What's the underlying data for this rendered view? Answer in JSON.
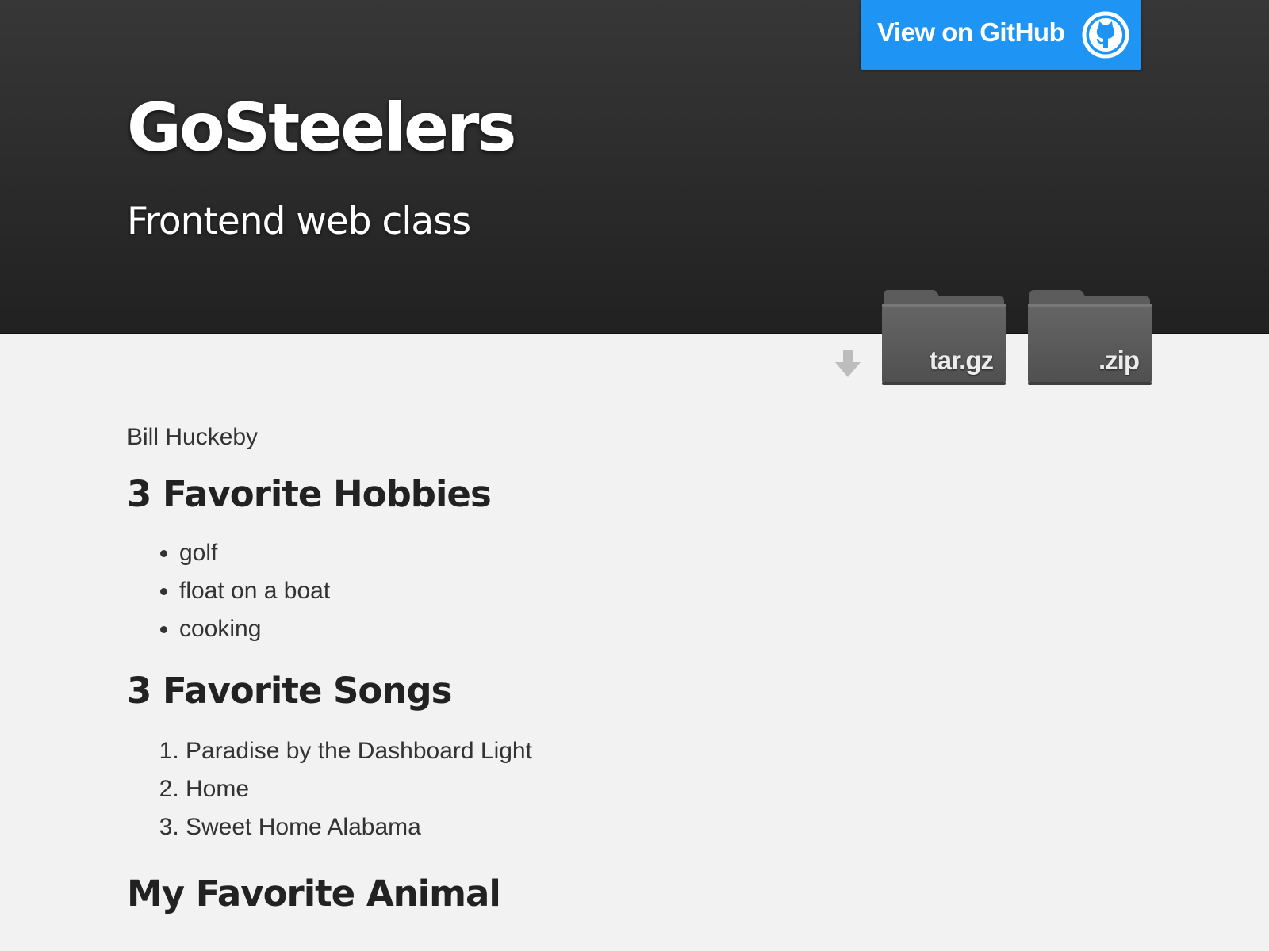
{
  "header": {
    "title": "GoSteelers",
    "subtitle": "Frontend web class"
  },
  "github_button": {
    "label": "View on GitHub",
    "icon": "github-octocat-icon",
    "color": "#1e95f5"
  },
  "downloads": {
    "arrow_icon": "download-arrow-icon",
    "items": [
      {
        "label": "tar.gz",
        "icon": "folder-icon"
      },
      {
        "label": ".zip",
        "icon": "folder-icon"
      }
    ]
  },
  "content": {
    "author": "Bill Huckeby",
    "hobbies": {
      "heading": "3 Favorite Hobbies",
      "items": [
        "golf",
        "float on a boat",
        "cooking"
      ]
    },
    "songs": {
      "heading": "3 Favorite Songs",
      "items": [
        "Paradise by the Dashboard Light",
        "Home",
        "Sweet Home Alabama"
      ]
    },
    "animal": {
      "heading": "My Favorite Animal"
    }
  }
}
